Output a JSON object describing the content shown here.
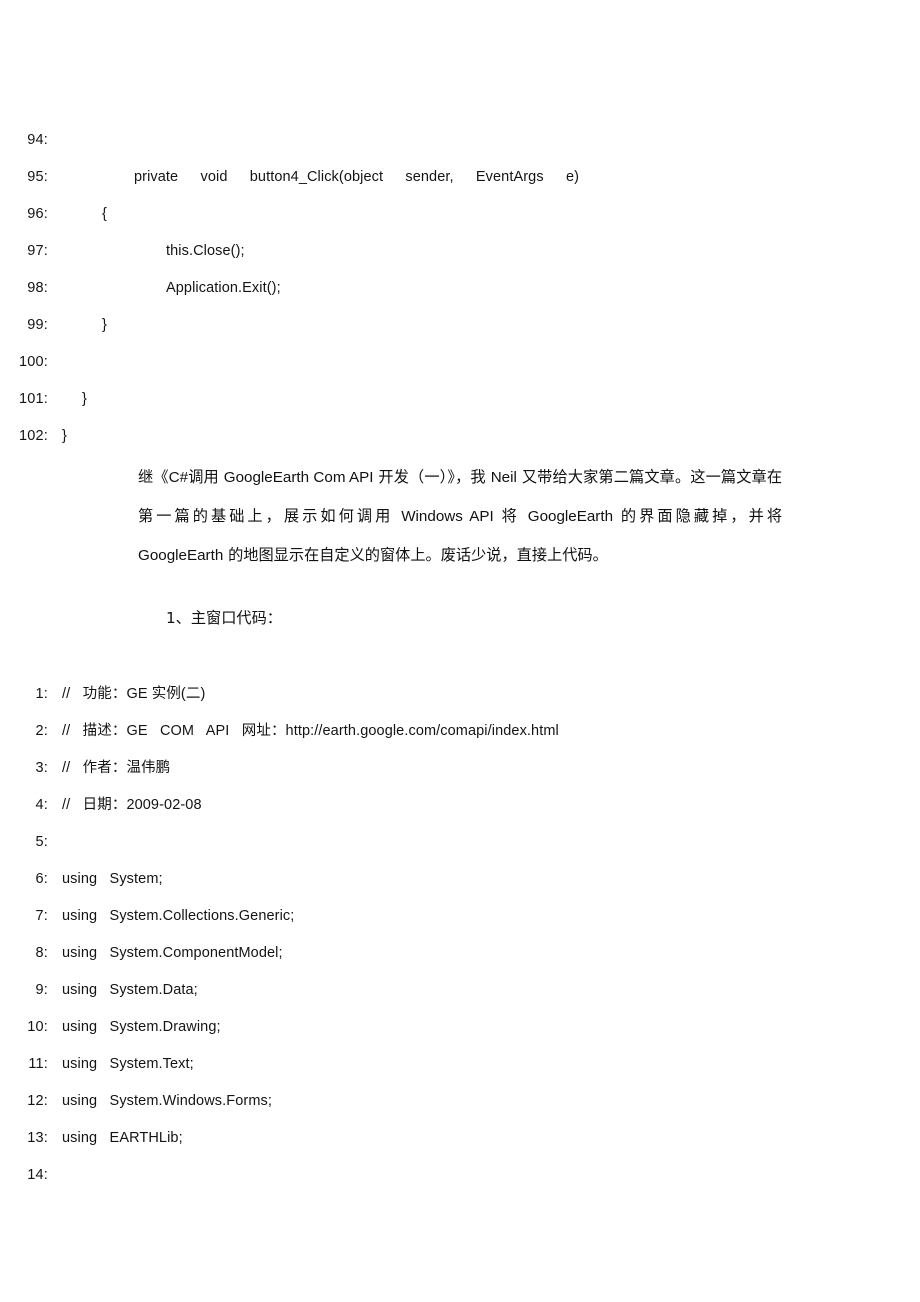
{
  "document": {
    "page_background": "#ffffff",
    "text_color": "#111111"
  },
  "code_block_1": {
    "lines": [
      {
        "num": "94:",
        "text": "",
        "indent": "i0",
        "spacing": ""
      },
      {
        "num": "95:",
        "text": "private  void  button4_Click(object  sender,  EventArgs  e)",
        "indent": "i4",
        "spacing": "ws-mid"
      },
      {
        "num": "96:",
        "text": "{",
        "indent": "i3",
        "spacing": ""
      },
      {
        "num": "97:",
        "text": "this.Close();",
        "indent": "i5",
        "spacing": ""
      },
      {
        "num": "98:",
        "text": "Application.Exit();",
        "indent": "i5",
        "spacing": ""
      },
      {
        "num": "99:",
        "text": "}",
        "indent": "i3",
        "spacing": ""
      },
      {
        "num": "100:",
        "text": "",
        "indent": "i0",
        "spacing": ""
      },
      {
        "num": "101:",
        "text": "}",
        "indent": "i2",
        "spacing": ""
      },
      {
        "num": "102:",
        "text": "}",
        "indent": "i1",
        "spacing": ""
      }
    ]
  },
  "paragraph": {
    "segments": [
      {
        "t": "继《",
        "latin": false
      },
      {
        "t": "C#",
        "latin": true
      },
      {
        "t": "调用 ",
        "latin": false
      },
      {
        "t": "GoogleEarth Com API",
        "latin": true
      },
      {
        "t": " 开发（一）》，我 ",
        "latin": false
      },
      {
        "t": "Neil",
        "latin": true
      },
      {
        "t": " 又带给大家第二篇文章。这一篇文章在第一篇的基础上，展示如何调用 ",
        "latin": false
      },
      {
        "t": "Windows API",
        "latin": true
      },
      {
        "t": " 将 ",
        "latin": false
      },
      {
        "t": "GoogleEarth",
        "latin": true
      },
      {
        "t": " 的界面隐藏掉，并将 ",
        "latin": false
      },
      {
        "t": "GoogleEarth",
        "latin": true
      },
      {
        "t": " 的地图显示在自定义的窗体上。废话少说，直接上代码。",
        "latin": false
      }
    ],
    "plain_text": "继《C#调用 GoogleEarth Com API 开发（一）》，我 Neil 又带给大家第二篇文章。这一篇文章在第一篇的基础上，展示如何调用 Windows API 将 GoogleEarth 的界面隐藏掉，并将 GoogleEarth 的地图显示在自定义的窗体上。废话少说，直接上代码。"
  },
  "section_heading": {
    "text": "1、主窗口代码："
  },
  "code_block_2": {
    "lines": [
      {
        "num": "1:",
        "text": "//   功能：GE 实例(二)",
        "indent": "i1",
        "spacing": ""
      },
      {
        "num": "2:",
        "text": "//   描述：GE   COM   API   网址：http://earth.google.com/comapi/index.html",
        "indent": "i1",
        "spacing": ""
      },
      {
        "num": "3:",
        "text": "//   作者：温伟鹏",
        "indent": "i1",
        "spacing": ""
      },
      {
        "num": "4:",
        "text": "//   日期：2009-02-08",
        "indent": "i1",
        "spacing": ""
      },
      {
        "num": "5:",
        "text": "",
        "indent": "i0",
        "spacing": ""
      },
      {
        "num": "6:",
        "text": "using   System;",
        "indent": "i1",
        "spacing": ""
      },
      {
        "num": "7:",
        "text": "using   System.Collections.Generic;",
        "indent": "i1",
        "spacing": ""
      },
      {
        "num": "8:",
        "text": "using   System.ComponentModel;",
        "indent": "i1",
        "spacing": ""
      },
      {
        "num": "9:",
        "text": "using   System.Data;",
        "indent": "i1",
        "spacing": ""
      },
      {
        "num": "10:",
        "text": "using   System.Drawing;",
        "indent": "i1",
        "spacing": ""
      },
      {
        "num": "11:",
        "text": "using   System.Text;",
        "indent": "i1",
        "spacing": ""
      },
      {
        "num": "12:",
        "text": "using   System.Windows.Forms;",
        "indent": "i1",
        "spacing": ""
      },
      {
        "num": "13:",
        "text": "using   EARTHLib;",
        "indent": "i1",
        "spacing": ""
      },
      {
        "num": "14:",
        "text": "",
        "indent": "i0",
        "spacing": ""
      }
    ]
  }
}
